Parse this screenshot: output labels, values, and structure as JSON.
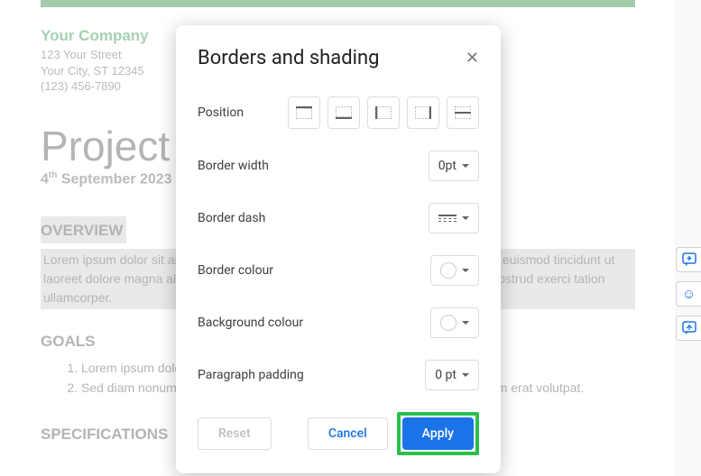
{
  "doc": {
    "company_name": "Your Company",
    "street": "123 Your Street",
    "city_line": "Your City, ST 12345",
    "phone": "(123) 456-7890",
    "title": "Project Name",
    "date_prefix": "4",
    "date_suffix": "th",
    "date_rest": " September 2023",
    "overview_head": "OVERVIEW",
    "overview_body": "Lorem ipsum dolor sit amet, consectetuer adipiscing elit, sed diam nonummy nibh euismod tincidunt ut laoreet dolore magna aliquam erat volutpat. Ut wisi enim ad minim veniam, quis nostrud exerci tation ullamcorper.",
    "goals_head": "GOALS",
    "goals": [
      "Lorem ipsum dolor sit amet, consectetuer adipiscing elit.",
      "Sed diam nonummy nibh euismod tincidunt ut laoreet dolore magna aliquam erat volutpat."
    ],
    "spec_head": "SPECIFICATIONS"
  },
  "dialog": {
    "title": "Borders and shading",
    "labels": {
      "position": "Position",
      "border_width": "Border width",
      "border_dash": "Border dash",
      "border_colour": "Border colour",
      "background_colour": "Background colour",
      "paragraph_padding": "Paragraph padding"
    },
    "values": {
      "border_width": "0pt",
      "paragraph_padding": "0 pt"
    },
    "buttons": {
      "reset": "Reset",
      "cancel": "Cancel",
      "apply": "Apply"
    }
  }
}
